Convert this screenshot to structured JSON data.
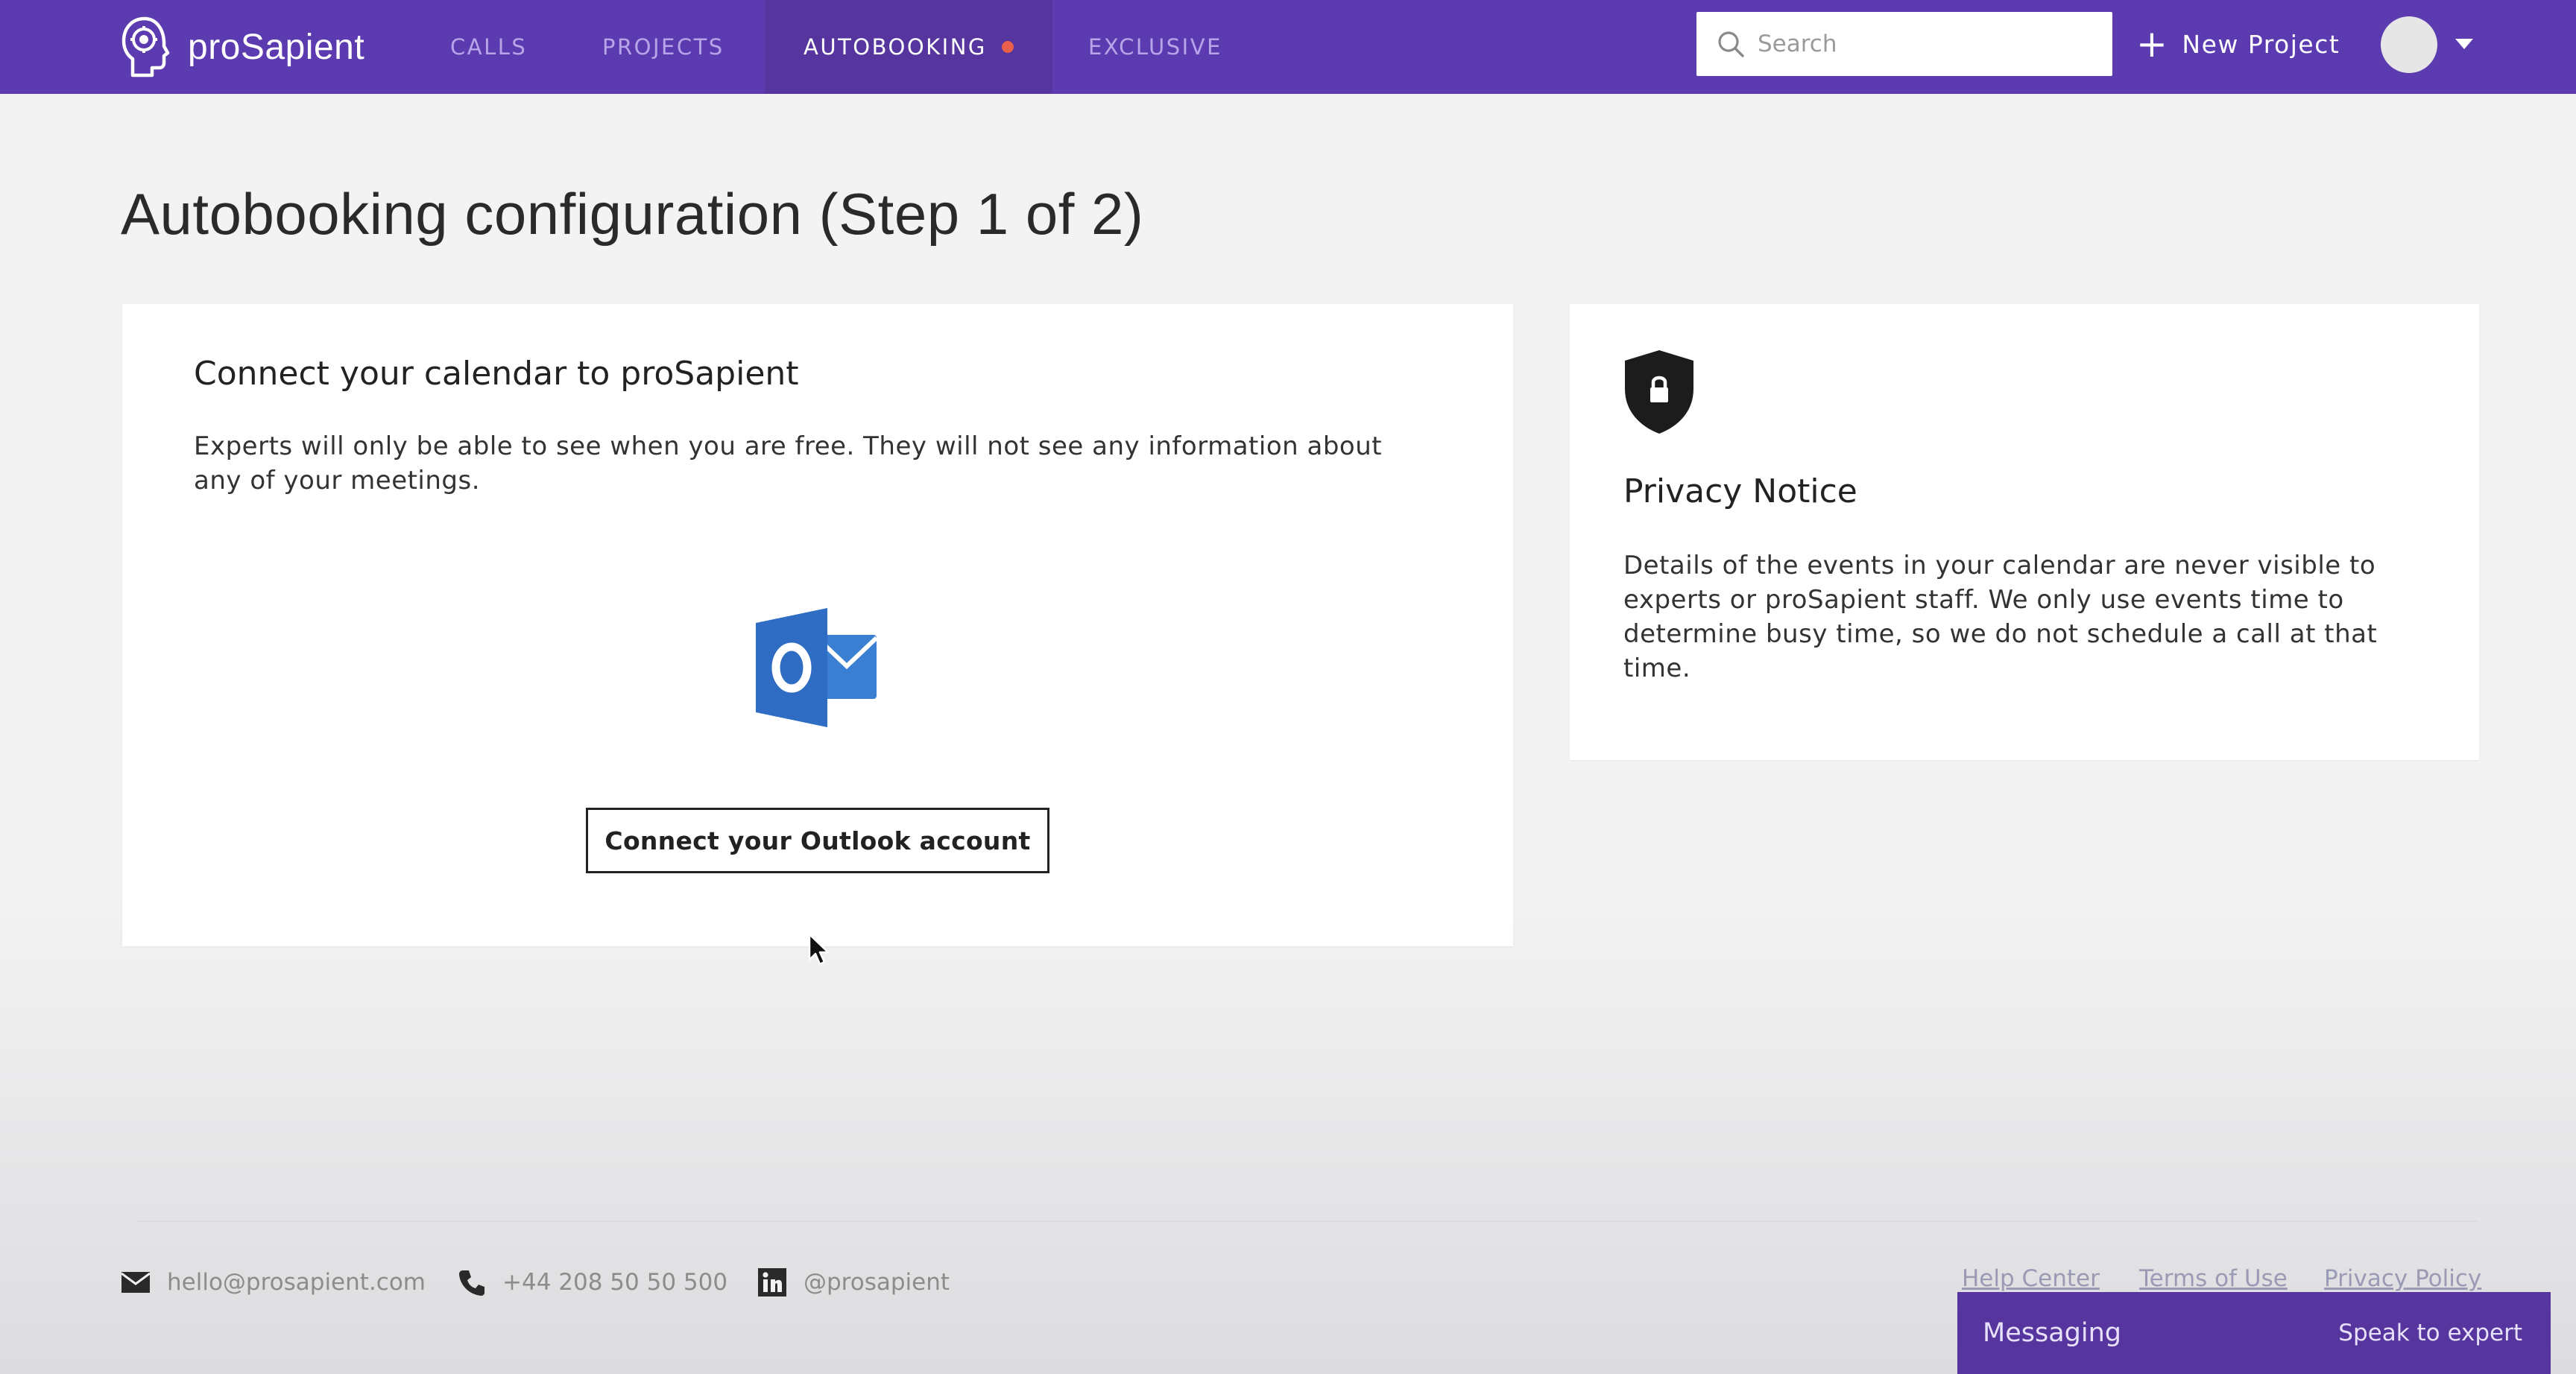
{
  "brand": {
    "name": "proSapient",
    "logo_icon": "brain-head-icon"
  },
  "nav": {
    "items": [
      {
        "label": "CALLS"
      },
      {
        "label": "PROJECTS"
      },
      {
        "label": "AUTOBOOKING",
        "active": true,
        "indicator_color": "#e8604c"
      },
      {
        "label": "EXCLUSIVE"
      }
    ],
    "search": {
      "placeholder": "Search",
      "value": ""
    },
    "new_project_label": "New Project"
  },
  "page": {
    "title": "Autobooking configuration (Step 1 of 2)"
  },
  "calendar_card": {
    "title": "Connect your calendar to proSapient",
    "description": "Experts will only be able to see when you are free. They will not see any information about any of your meetings.",
    "provider_icon": "outlook-icon",
    "connect_button_label": "Connect your Outlook account"
  },
  "privacy_card": {
    "icon": "shield-lock-icon",
    "title": "Privacy Notice",
    "body": "Details of the events in your calendar are never visible to experts or proSapient staff. We only use events time to determine busy time, so we do not schedule a call at that time."
  },
  "footer": {
    "email": "hello@prosapient.com",
    "phone": "+44 208 50 50 500",
    "linkedin": "@prosapient",
    "links": [
      {
        "label": "Help Center"
      },
      {
        "label": "Terms of Use"
      },
      {
        "label": "Privacy Policy"
      }
    ]
  },
  "messaging": {
    "label": "Messaging",
    "action": "Speak to expert"
  },
  "colors": {
    "navbar": "#5c3ab0",
    "navbar_active": "#56359f",
    "outlook_blue": "#2f6cc4",
    "indicator": "#e8604c",
    "page_background": "#f3f3f3"
  }
}
